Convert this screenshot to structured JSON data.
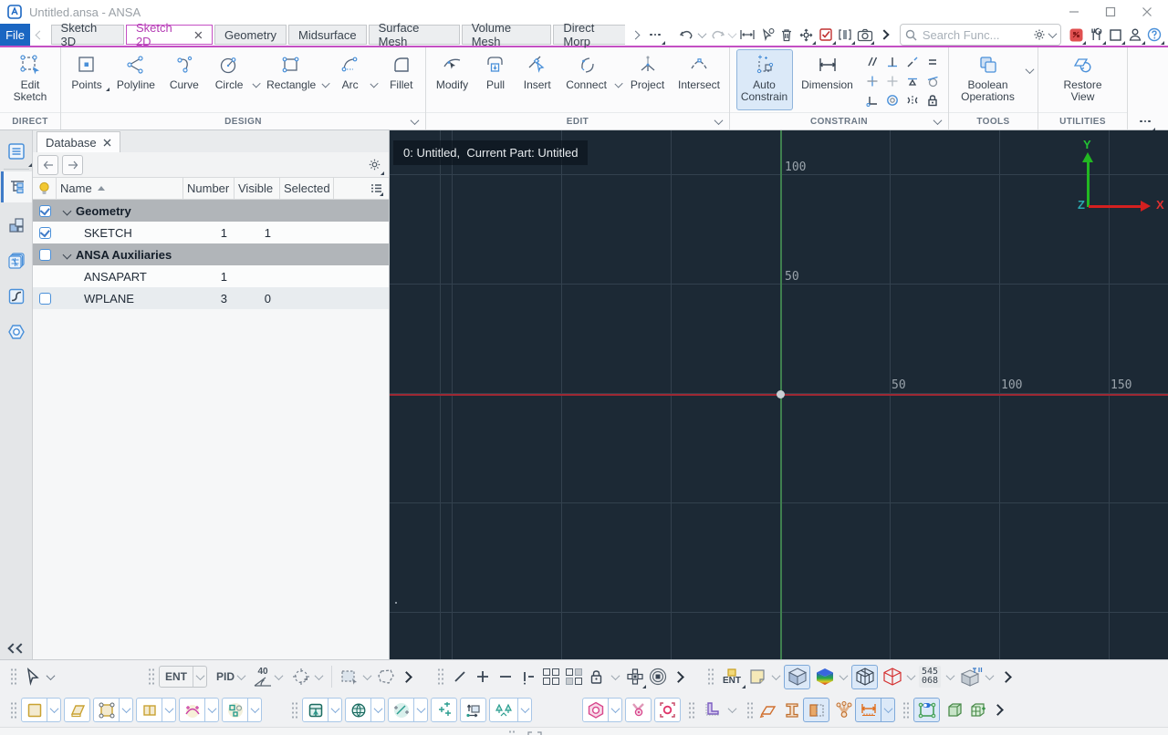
{
  "window": {
    "title": "Untitled.ansa - ANSA"
  },
  "menubar": {
    "file_label": "File",
    "tabs": [
      {
        "label": "Sketch 3D"
      },
      {
        "label": "Sketch 2D"
      },
      {
        "label": "Geometry"
      },
      {
        "label": "Midsurface"
      },
      {
        "label": "Surface Mesh"
      },
      {
        "label": "Volume Mesh"
      },
      {
        "label": "Direct Morp"
      }
    ],
    "active_tab": "Sketch 2D",
    "search_placeholder": "Search Func..."
  },
  "ribbon": {
    "direct_label": "DIRECT",
    "design_label": "DESIGN",
    "edit_label": "EDIT",
    "constrain_label": "CONSTRAIN",
    "tools_label": "TOOLS",
    "utilities_label": "UTILITIES",
    "buttons": {
      "edit_sketch": "Edit Sketch",
      "points": "Points",
      "polyline": "Polyline",
      "curve": "Curve",
      "circle": "Circle",
      "rectangle": "Rectangle",
      "arc": "Arc",
      "fillet": "Fillet",
      "modify": "Modify",
      "pull": "Pull",
      "insert": "Insert",
      "connect": "Connect",
      "project": "Project",
      "intersect": "Intersect",
      "auto_constrain": "Auto Constrain",
      "dimension": "Dimension",
      "boolean_operations": "Boolean Operations",
      "restore_view": "Restore View"
    }
  },
  "database": {
    "tab_label": "Database",
    "columns": {
      "name": "Name",
      "number": "Number",
      "visible": "Visible",
      "selected": "Selected"
    },
    "rows": [
      {
        "name": "Geometry",
        "number": "",
        "visible": "",
        "selected": "",
        "group": true,
        "checked": true
      },
      {
        "name": "SKETCH",
        "number": "1",
        "visible": "1",
        "selected": "",
        "checked": true
      },
      {
        "name": "ANSA Auxiliaries",
        "number": "",
        "visible": "",
        "selected": "",
        "group": true,
        "checked": false
      },
      {
        "name": "ANSAPART",
        "number": "1",
        "visible": "",
        "selected": ""
      },
      {
        "name": "WPLANE",
        "number": "3",
        "visible": "0",
        "selected": "",
        "checked": false
      }
    ]
  },
  "viewport": {
    "status_text": "0: Untitled,  Current Part: Untitled",
    "y_labels": [
      "100",
      "50"
    ],
    "x_labels": [
      "50",
      "100",
      "150"
    ],
    "triad": {
      "x": "X",
      "y": "Y",
      "z": "Z"
    },
    "colors": {
      "background": "#1c2935",
      "grid": "#33414e",
      "x_axis": "#9e2833",
      "y_axis": "#3f7f4f",
      "accent": "#c44fc4"
    }
  },
  "bottom": {
    "ent_label": "ENT",
    "pid_label": "PID",
    "angle_value": "40",
    "ent2_label": "ENT",
    "counter_top": "545",
    "counter_bottom": "068"
  }
}
